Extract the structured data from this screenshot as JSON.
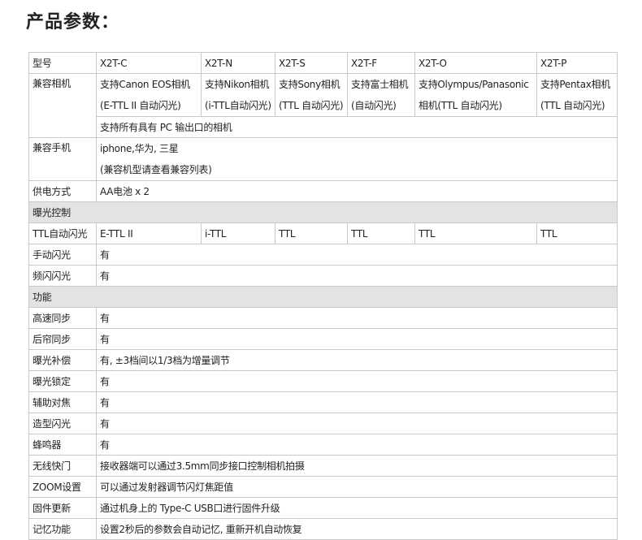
{
  "title": "产品参数：",
  "models_row": {
    "label": "型号",
    "models": [
      "X2T-C",
      "X2T-N",
      "X2T-S",
      "X2T-F",
      "X2T-O",
      "X2T-P"
    ]
  },
  "compat_camera": {
    "label": "兼容相机",
    "cells": [
      [
        "支持Canon EOS相机",
        "(E-TTL II 自动闪光)"
      ],
      [
        "支持Nikon相机",
        "(i-TTL自动闪光)"
      ],
      [
        "支持Sony相机",
        "(TTL 自动闪光)"
      ],
      [
        "支持富士相机",
        "(自动闪光)"
      ],
      [
        "支持Olympus/Panasonic",
        "相机(TTL 自动闪光)"
      ],
      [
        "支持Pentax相机",
        "(TTL 自动闪光)"
      ]
    ],
    "pc_note": "支持所有具有 PC 输出口的相机"
  },
  "compat_phone": {
    "label": "兼容手机",
    "line1": "iphone,华为, 三星",
    "line2": "(兼容机型请查看兼容列表)"
  },
  "power": {
    "label": "供电方式",
    "value": "AA电池 x 2"
  },
  "exposure_section": "曝光控制",
  "ttl_row": {
    "label": "TTL自动闪光",
    "values": [
      "E-TTL II",
      "i-TTL",
      "TTL",
      "TTL",
      "TTL",
      "TTL"
    ]
  },
  "manual_flash": {
    "label": "手动闪光",
    "value": "有"
  },
  "multi_flash": {
    "label": "频闪闪光",
    "value": "有"
  },
  "function_section": "功能",
  "features": [
    {
      "label": "高速同步",
      "value": "有"
    },
    {
      "label": "后帘同步",
      "value": "有"
    },
    {
      "label": "曝光补偿",
      "value": "有, ±3档间以1/3档为增量调节"
    },
    {
      "label": "曝光锁定",
      "value": "有"
    },
    {
      "label": "辅助对焦",
      "value": "有"
    },
    {
      "label": "造型闪光",
      "value": "有"
    },
    {
      "label": "蜂鸣器",
      "value": "有"
    },
    {
      "label": "无线快门",
      "value": "接收器端可以通过3.5mm同步接口控制相机拍摄"
    },
    {
      "label": "ZOOM设置",
      "value": "可以通过发射器调节闪灯焦距值"
    },
    {
      "label": "固件更新",
      "value": "通过机身上的 Type-C USB口进行固件升级"
    },
    {
      "label": "记忆功能",
      "value": "设置2秒后的参数会自动记忆, 重新开机自动恢复"
    }
  ]
}
